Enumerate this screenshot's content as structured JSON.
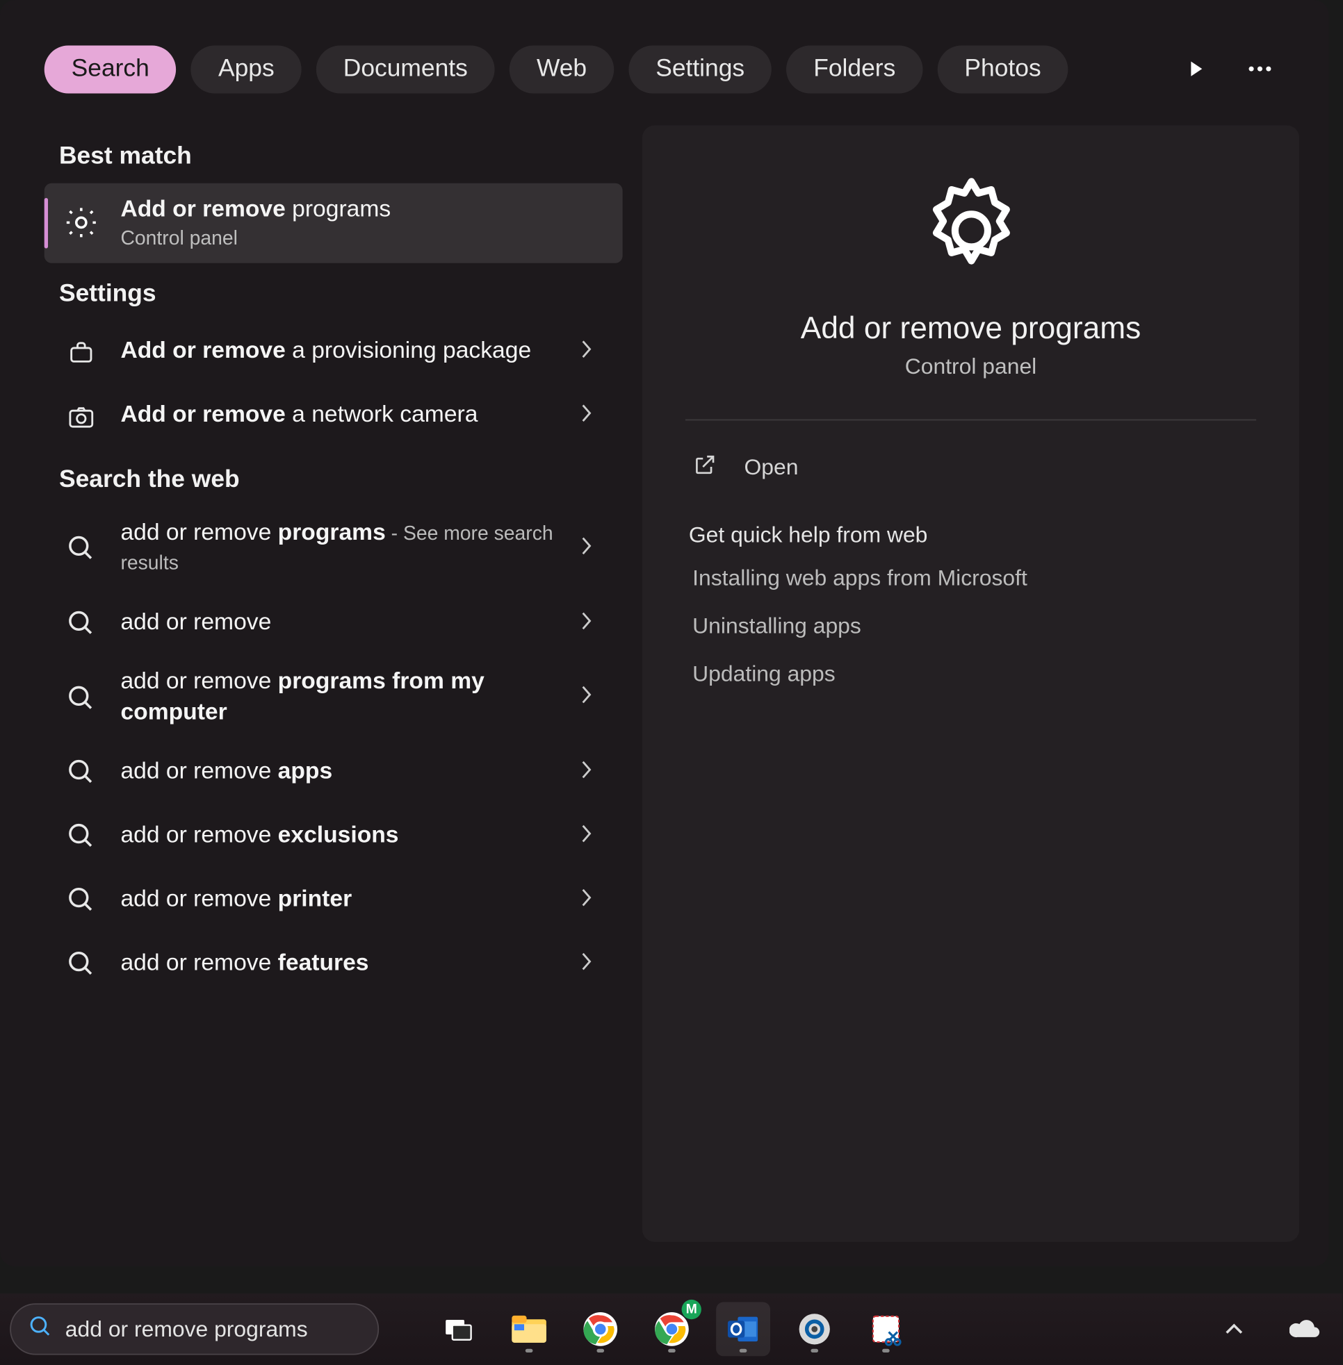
{
  "tabs": [
    {
      "label": "Search",
      "active": true
    },
    {
      "label": "Apps",
      "active": false
    },
    {
      "label": "Documents",
      "active": false
    },
    {
      "label": "Web",
      "active": false
    },
    {
      "label": "Settings",
      "active": false
    },
    {
      "label": "Folders",
      "active": false
    },
    {
      "label": "Photos",
      "active": false
    }
  ],
  "sections": {
    "best_match": {
      "header": "Best match",
      "item": {
        "title_bold": "Add or remove",
        "title_rest": " programs",
        "subtitle": "Control panel"
      }
    },
    "settings": {
      "header": "Settings",
      "items": [
        {
          "bold": "Add or remove",
          "rest": " a provisioning package",
          "icon": "briefcase"
        },
        {
          "bold": "Add or remove",
          "rest": " a network camera",
          "icon": "camera"
        }
      ]
    },
    "web": {
      "header": "Search the web",
      "items": [
        {
          "pre": "add or remove ",
          "bold": "programs",
          "suffix": " - See more search results"
        },
        {
          "pre": "add or remove",
          "bold": "",
          "suffix": ""
        },
        {
          "pre": "add or remove ",
          "bold": "programs from my computer",
          "suffix": ""
        },
        {
          "pre": "add or remove ",
          "bold": "apps",
          "suffix": ""
        },
        {
          "pre": "add or remove ",
          "bold": "exclusions",
          "suffix": ""
        },
        {
          "pre": "add or remove ",
          "bold": "printer",
          "suffix": ""
        },
        {
          "pre": "add or remove ",
          "bold": "features",
          "suffix": ""
        }
      ]
    }
  },
  "detail": {
    "title": "Add or remove programs",
    "subtitle": "Control panel",
    "open_label": "Open",
    "quick_help_header": "Get quick help from web",
    "quick_links": [
      "Installing web apps from Microsoft",
      "Uninstalling apps",
      "Updating apps"
    ]
  },
  "taskbar": {
    "search_value": "add or remove programs"
  }
}
